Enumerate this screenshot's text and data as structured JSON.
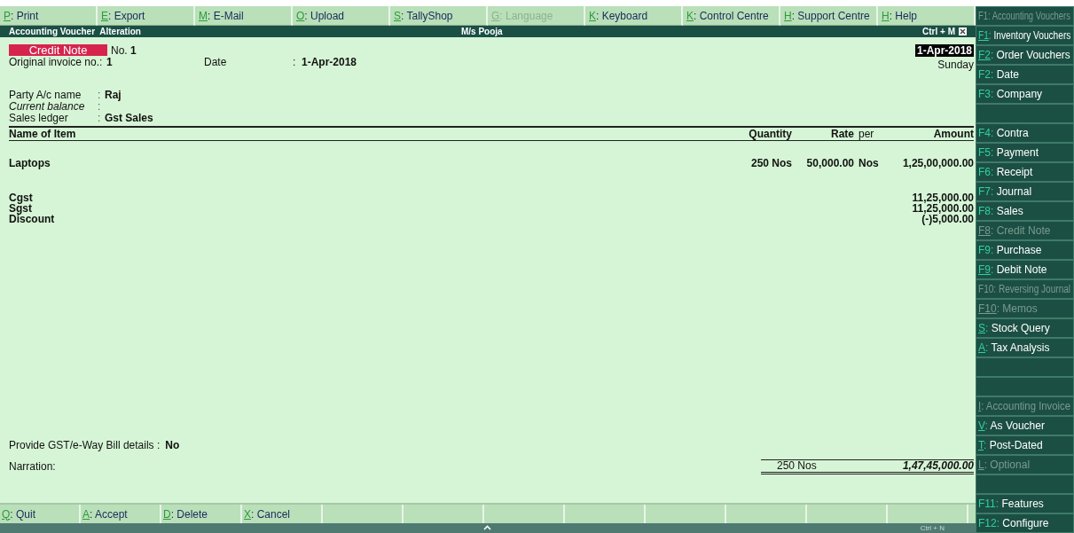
{
  "top_menu": [
    {
      "key": "P",
      "label": ": Print",
      "disabled": false
    },
    {
      "key": "E",
      "label": ": Export",
      "disabled": false
    },
    {
      "key": "M",
      "label": ": E-Mail",
      "disabled": false
    },
    {
      "key": "O",
      "label": ": Upload",
      "disabled": false
    },
    {
      "key": "S",
      "label": ": TallyShop",
      "disabled": false
    },
    {
      "key": "G",
      "label": ": Language",
      "disabled": true
    },
    {
      "key": "K",
      "label": ": Keyboard",
      "disabled": false
    },
    {
      "key": "K",
      "label": ": Control Centre",
      "disabled": false
    },
    {
      "key": "H",
      "label": ": Support Centre",
      "disabled": false
    },
    {
      "key": "H",
      "label": ": Help",
      "disabled": false
    }
  ],
  "header": {
    "title": "Accounting Voucher",
    "mode": "Alteration",
    "company": "M/s Pooja",
    "shortcut": "Ctrl + M"
  },
  "voucher": {
    "type": "Credit Note",
    "number_label": "No.",
    "number": "1",
    "date": "1-Apr-2018",
    "day": "Sunday"
  },
  "original_invoice": {
    "label": "Original invoice no.:",
    "value": "1",
    "date_label": "Date",
    "date_sep": ":",
    "date": "1-Apr-2018"
  },
  "party_fields": [
    {
      "label": "Party A/c name",
      "sep": ":",
      "value": "Raj",
      "italic": false
    },
    {
      "label": "Current balance",
      "sep": ":",
      "italic": true
    },
    {
      "label": "Sales ledger",
      "sep": ":",
      "value": "Gst Sales",
      "italic": false
    }
  ],
  "table": {
    "columns": [
      "Name of Item",
      "Quantity",
      "Rate",
      "per",
      "Amount"
    ],
    "rows": [
      {
        "kind": "item",
        "name": "Laptops",
        "quantity": "250 Nos",
        "rate": "50,000.00",
        "per": "Nos",
        "amount": "1,25,00,000.00"
      },
      {
        "kind": "spacer"
      },
      {
        "kind": "ledger",
        "name": "Cgst",
        "amount": "11,25,000.00"
      },
      {
        "kind": "ledger",
        "name": "Sgst",
        "amount": "11,25,000.00"
      },
      {
        "kind": "ledger",
        "name": "Discount",
        "amount": "(-)5,000.00"
      }
    ]
  },
  "gst_details": {
    "label": "Provide GST/e-Way Bill details :",
    "value": "No"
  },
  "narration": {
    "label": "Narration:"
  },
  "totals": {
    "quantity": "250 Nos",
    "amount": "1,47,45,000.00"
  },
  "bottom_menu": [
    {
      "key": "Q",
      "label": ": Quit"
    },
    {
      "key": "A",
      "label": ": Accept"
    },
    {
      "key": "D",
      "label": ": Delete"
    },
    {
      "key": "X",
      "label": ": Cancel"
    }
  ],
  "status_bar": {
    "shortcut": "Ctrl + N"
  },
  "sidebar": [
    {
      "kind": "action",
      "key": "F1",
      "label": ": Accounting Vouchers",
      "disabled": true,
      "underlined": false
    },
    {
      "kind": "action",
      "key": "F1",
      "label": ": Inventory Vouchers",
      "disabled": false,
      "underlined": true
    },
    {
      "kind": "action",
      "key": "F2",
      "label": ": Order Vouchers",
      "disabled": false,
      "underlined": true
    },
    {
      "kind": "action",
      "key": "F2",
      "label": ": Date",
      "disabled": false,
      "underlined": false
    },
    {
      "kind": "action",
      "key": "F3",
      "label": ": Company",
      "disabled": false,
      "underlined": false
    },
    {
      "kind": "blank"
    },
    {
      "kind": "action",
      "key": "F4",
      "label": ": Contra",
      "disabled": false,
      "underlined": false
    },
    {
      "kind": "action",
      "key": "F5",
      "label": ": Payment",
      "disabled": false,
      "underlined": false
    },
    {
      "kind": "action",
      "key": "F6",
      "label": ": Receipt",
      "disabled": false,
      "underlined": false
    },
    {
      "kind": "action",
      "key": "F7",
      "label": ": Journal",
      "disabled": false,
      "underlined": false
    },
    {
      "kind": "action",
      "key": "F8",
      "label": ": Sales",
      "disabled": false,
      "underlined": false
    },
    {
      "kind": "action",
      "key": "F8",
      "label": ": Credit Note",
      "disabled": true,
      "underlined": true
    },
    {
      "kind": "action",
      "key": "F9",
      "label": ": Purchase",
      "disabled": false,
      "underlined": false
    },
    {
      "kind": "action",
      "key": "F9",
      "label": ": Debit Note",
      "disabled": false,
      "underlined": true
    },
    {
      "kind": "action",
      "key": "F10",
      "label": ": Reversing Journal",
      "disabled": true,
      "underlined": false
    },
    {
      "kind": "action",
      "key": "F10",
      "label": ": Memos",
      "disabled": true,
      "underlined": true
    },
    {
      "kind": "action",
      "key": "S",
      "label": ": Stock Query",
      "disabled": false,
      "underlined": true
    },
    {
      "kind": "action",
      "key": "A",
      "label": ": Tax Analysis",
      "disabled": false,
      "underlined": true
    },
    {
      "kind": "blank"
    },
    {
      "kind": "blank"
    },
    {
      "kind": "action",
      "key": "I",
      "label": ": Accounting Invoice",
      "disabled": true,
      "underlined": true
    },
    {
      "kind": "action",
      "key": "V",
      "label": ": As Voucher",
      "disabled": false,
      "underlined": true
    },
    {
      "kind": "action",
      "key": "T",
      "label": ": Post-Dated",
      "disabled": false,
      "underlined": true
    },
    {
      "kind": "action",
      "key": "L",
      "label": ": Optional",
      "disabled": true,
      "underlined": true
    },
    {
      "kind": "blank"
    },
    {
      "kind": "action",
      "key": "F11",
      "label": ": Features",
      "disabled": false,
      "underlined": false
    },
    {
      "kind": "action",
      "key": "F12",
      "label": ": Configure",
      "disabled": false,
      "underlined": false
    }
  ]
}
